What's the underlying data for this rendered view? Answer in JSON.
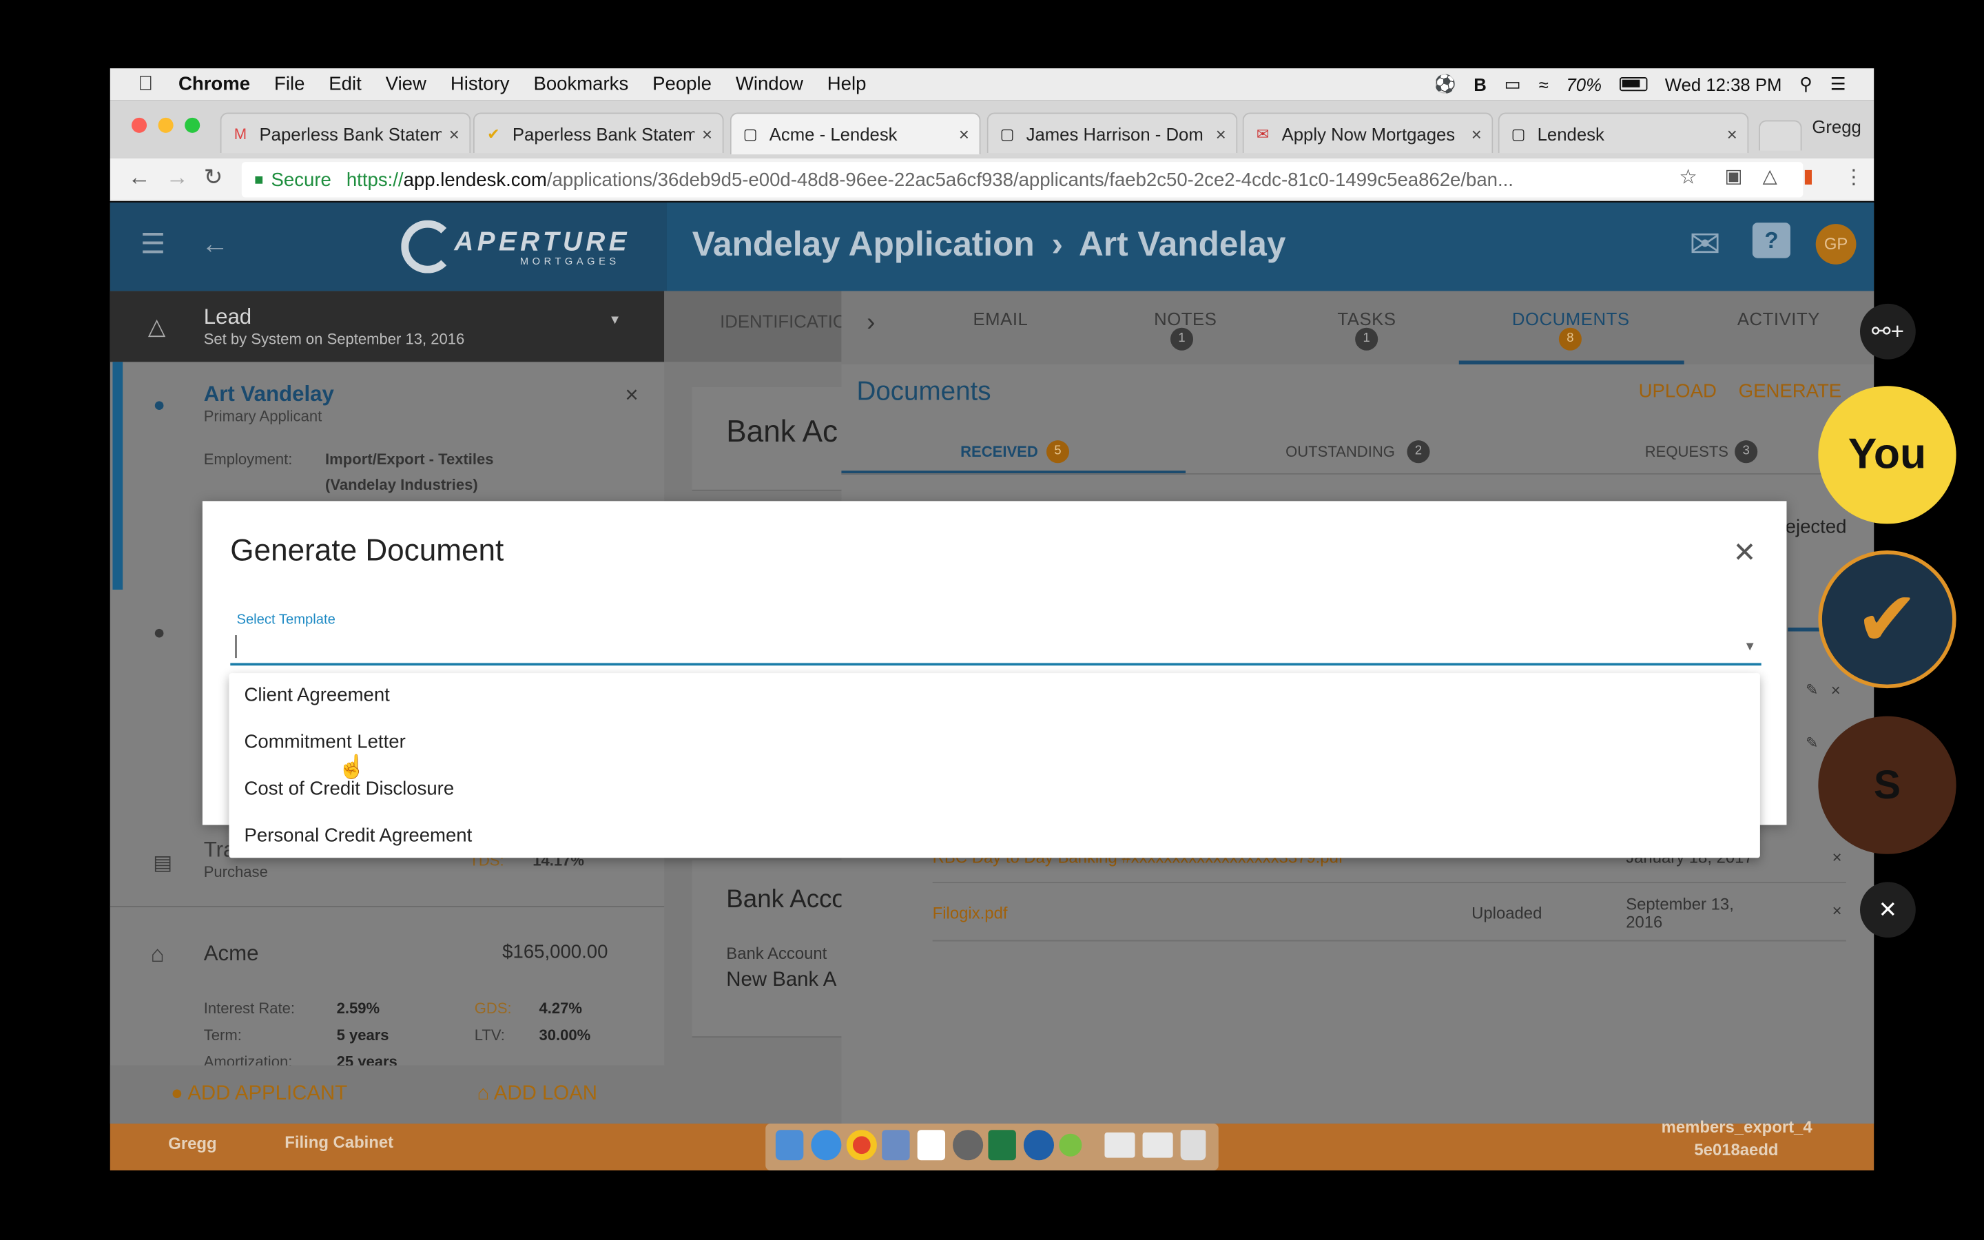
{
  "menubar": {
    "items": [
      "Chrome",
      "File",
      "Edit",
      "View",
      "History",
      "Bookmarks",
      "People",
      "Window",
      "Help"
    ],
    "battery": "70%",
    "clock": "Wed 12:38 PM"
  },
  "tabs": [
    {
      "title": "Paperless Bank Statem",
      "icon": "gmail-icon"
    },
    {
      "title": "Paperless Bank Statem",
      "icon": "check-icon"
    },
    {
      "title": "Acme - Lendesk",
      "icon": "page-icon"
    },
    {
      "title": "James Harrison - Dom",
      "icon": "page-icon"
    },
    {
      "title": "Apply Now Mortgages",
      "icon": "mail-icon"
    },
    {
      "title": "Lendesk",
      "icon": "page-icon"
    }
  ],
  "profile_name": "Gregg",
  "address": {
    "secure_label": "Secure",
    "proto": "https://",
    "domain": "app.lendesk.com",
    "path": "/applications/36deb9d5-e00d-48d8-96ee-22ac5a6cf938/applicants/faeb2c50-2ce2-4cdc-81c0-1499c5ea862e/ban..."
  },
  "app": {
    "logo_text": "APERTURE",
    "logo_sub": "MORTGAGES",
    "title": "Vandelay Application",
    "title_sep": "›",
    "title_sub": "Art Vandelay",
    "avatar_initials": "GP",
    "lead": {
      "label": "Lead",
      "sub": "Set by System on September 13, 2016"
    },
    "applicant": {
      "name": "Art Vandelay",
      "role": "Primary Applicant",
      "employment_label": "Employment:",
      "employment_value": "Import/Export - Textiles",
      "employment_company": "(Vandelay Industries)"
    },
    "transaction": {
      "label": "Transaction",
      "sub": "Purchase",
      "tds_label": "TDS:",
      "tds_value": "14.17%"
    },
    "loan": {
      "lender": "Acme",
      "amount": "$165,000.00",
      "rate_label": "Interest Rate:",
      "rate_value": "2.59%",
      "gds_label": "GDS:",
      "gds_value": "4.27%",
      "term_label": "Term:",
      "term_value": "5 years",
      "ltv_label": "LTV:",
      "ltv_value": "30.00%",
      "amort_label": "Amortization:",
      "amort_value": "25 years"
    },
    "add_applicant": "ADD APPLICANT",
    "add_loan": "ADD LOAN",
    "identification_tab": "IDENTIFICATIO",
    "bank_heading": "Bank Ac",
    "bank_heading2": "Bank Acco",
    "bank_account_label": "Bank Account",
    "bank_account_value": "New Bank A",
    "right_tabs": [
      {
        "label": "EMAIL",
        "count": ""
      },
      {
        "label": "NOTES",
        "count": "1"
      },
      {
        "label": "TASKS",
        "count": "1"
      },
      {
        "label": "DOCUMENTS",
        "count": "8"
      },
      {
        "label": "ACTIVITY",
        "count": ""
      }
    ],
    "documents_title": "Documents",
    "upload": "UPLOAD",
    "generate": "GENERATE",
    "subtabs": [
      {
        "label": "RECEIVED",
        "count": "5"
      },
      {
        "label": "OUTSTANDING",
        "count": "2"
      },
      {
        "label": "REQUESTS",
        "count": "3"
      }
    ],
    "rejected_label": "ejected",
    "doc_rows": [
      {
        "name": "RBC Day to Day Banking #xxxxxxxxxxxxxxxxxx3379.pdf",
        "status": "",
        "date": "January 18, 2017"
      },
      {
        "name": "Filogix.pdf",
        "status": "Uploaded",
        "date": "September 13, 2016"
      }
    ]
  },
  "modal": {
    "title": "Generate Document",
    "field_label": "Select Template",
    "field_value": "",
    "options": [
      "Client Agreement",
      "Commitment Letter",
      "Cost of Credit Disclosure",
      "Personal Credit Agreement"
    ]
  },
  "dock": {
    "left_items": [
      "Gregg",
      "Filing Cabinet"
    ],
    "right_file": "members_export_4",
    "right_file2": "5e018aedd"
  },
  "meeting": {
    "you_label": "You",
    "participant_initial": "S"
  }
}
